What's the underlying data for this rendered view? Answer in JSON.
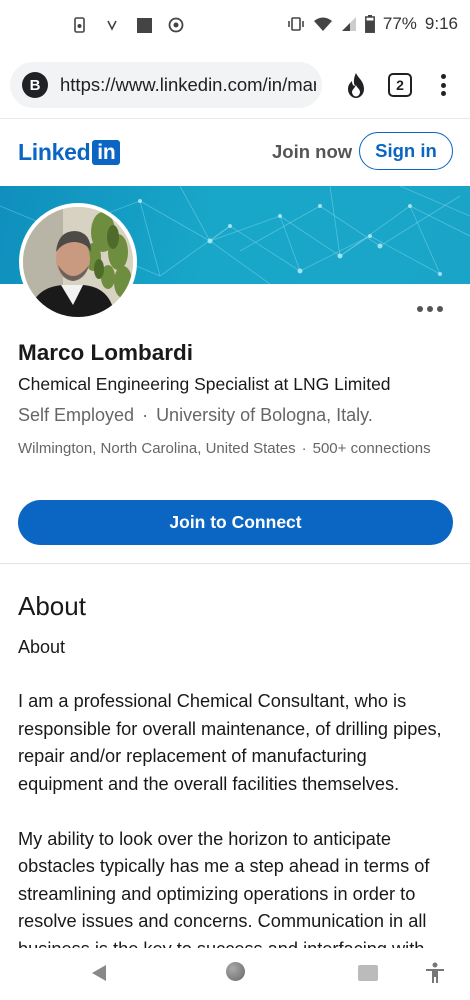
{
  "status_bar": {
    "battery": "77%",
    "time": "9:16"
  },
  "browser": {
    "favicon_letter": "B",
    "url": "https://www.linkedin.com/in/marco-lombardi",
    "tab_count": "2"
  },
  "header": {
    "logo_text": "Linked",
    "logo_in": "in",
    "join_now": "Join now",
    "sign_in": "Sign in"
  },
  "profile": {
    "name": "Marco Lombardi",
    "headline": "Chemical Engineering Specialist at LNG Limited",
    "employer": "Self Employed",
    "school": "University of Bologna, Italy.",
    "location": "Wilmington, North Carolina, United States",
    "connections": "500+ connections",
    "connect_button": "Join to Connect"
  },
  "about": {
    "title": "About",
    "label": "About",
    "text": "I am a professional Chemical Consultant, who is responsible for overall maintenance, of drilling pipes, repair and/or replacement of manufacturing equipment and the overall facilities themselves.\n\nMy ability to look over the horizon to anticipate obstacles typically has me a step ahead in terms of streamlining and optimizing operations in order to resolve issues and concerns. Communication in all business is the key to success and interfacing with"
  },
  "colors": {
    "brand": "#0a66c2",
    "cover_start": "#0f8fbd",
    "cover_end": "#1aa5c8"
  },
  "icons": {
    "flame": "flame-icon",
    "tabs": "tabs-icon",
    "menu": "menu-icon",
    "back": "back-icon",
    "home": "home-icon",
    "recent": "recent-apps-icon",
    "accessibility": "accessibility-icon"
  }
}
